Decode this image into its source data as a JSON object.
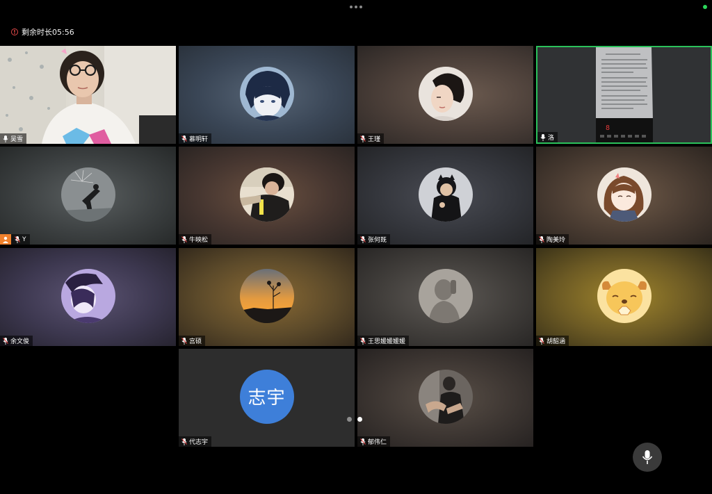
{
  "meeting": {
    "remaining_time": "剩余时长05:56"
  },
  "participants": [
    {
      "name": "吴雪",
      "mic": "on"
    },
    {
      "name": "慕明轩",
      "mic": "muted"
    },
    {
      "name": "王瑾",
      "mic": "muted"
    },
    {
      "name": "洛",
      "mic": "on",
      "active_speaker": true
    },
    {
      "name": "Y",
      "mic": "muted",
      "host": true
    },
    {
      "name": "牛映松",
      "mic": "muted"
    },
    {
      "name": "张何既",
      "mic": "muted"
    },
    {
      "name": "陶美玲",
      "mic": "muted"
    },
    {
      "name": "余文俊",
      "mic": "muted"
    },
    {
      "name": "宫硕",
      "mic": "muted"
    },
    {
      "name": "王思媛媛媛媛",
      "mic": "muted"
    },
    {
      "name": "胡韶涵",
      "mic": "muted"
    },
    {
      "name": "代志宇",
      "mic": "muted",
      "avatar_text": "志宇"
    },
    {
      "name": "郁伟仁",
      "mic": "muted"
    }
  ],
  "pagination": {
    "current": 2,
    "total": 2
  },
  "colors": {
    "active_border": "#2bc25b",
    "host_badge": "#f0812c",
    "text_avatar_bg": "#3e7fd9",
    "warning": "#e04848"
  }
}
